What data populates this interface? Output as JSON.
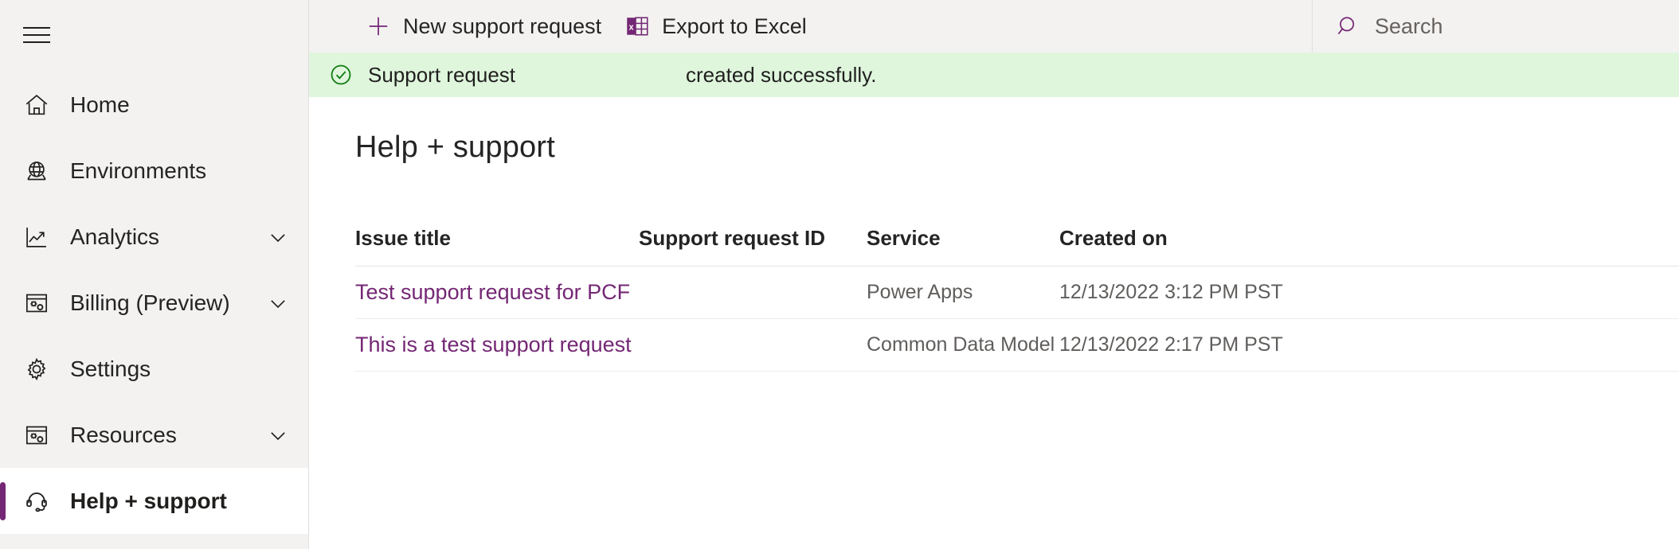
{
  "sidebar": {
    "menu_toggle_name": "hamburger-menu",
    "items": [
      {
        "label": "Home",
        "icon": "home-icon",
        "chevron": false,
        "selected": false
      },
      {
        "label": "Environments",
        "icon": "globe-icon",
        "chevron": false,
        "selected": false
      },
      {
        "label": "Analytics",
        "icon": "analytics-icon",
        "chevron": true,
        "selected": false
      },
      {
        "label": "Billing (Preview)",
        "icon": "billing-icon",
        "chevron": true,
        "selected": false
      },
      {
        "label": "Settings",
        "icon": "gear-icon",
        "chevron": false,
        "selected": false
      },
      {
        "label": "Resources",
        "icon": "resources-icon",
        "chevron": true,
        "selected": false
      },
      {
        "label": "Help + support",
        "icon": "headset-icon",
        "chevron": false,
        "selected": true
      }
    ]
  },
  "commandbar": {
    "new_request_label": "New support request",
    "export_label": "Export to Excel",
    "accent_color": "#742774"
  },
  "search": {
    "value": "",
    "placeholder": "Search"
  },
  "banner": {
    "status": "success",
    "background_color": "#dff6dd",
    "icon_color": "#107c10",
    "text_prefix": "Support request",
    "request_id": "",
    "text_suffix": "created successfully."
  },
  "page": {
    "title": "Help + support"
  },
  "table": {
    "columns": [
      "Issue title",
      "Support request ID",
      "Service",
      "Created on"
    ],
    "rows": [
      {
        "issue_title": "Test support request for PCF",
        "support_request_id": "",
        "service": "Power Apps",
        "created_on": "12/13/2022 3:12 PM PST"
      },
      {
        "issue_title": "This is a test support request",
        "support_request_id": "",
        "service": "Common Data Model",
        "created_on": "12/13/2022 2:17 PM PST"
      }
    ]
  }
}
